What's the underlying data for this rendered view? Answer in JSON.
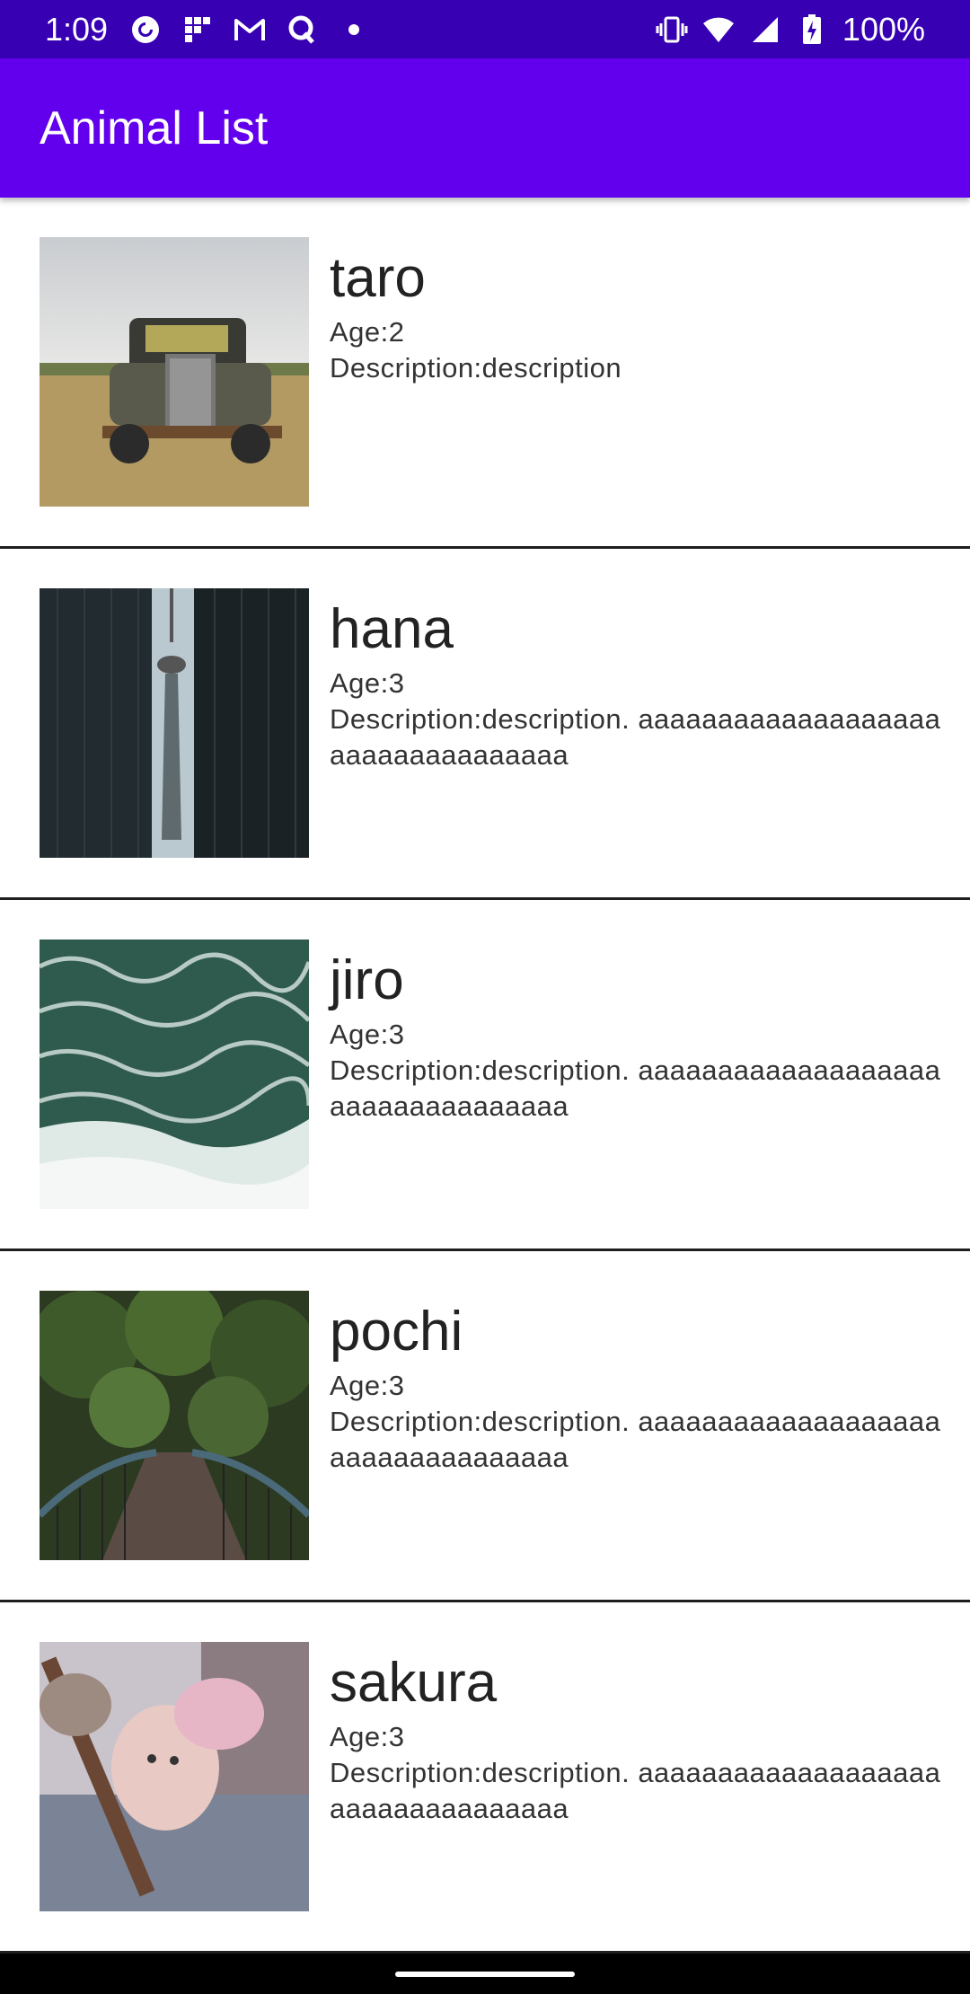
{
  "status_bar": {
    "time": "1:09",
    "battery": "100%",
    "left_icons": [
      "pocket-casts-icon",
      "grid-app-icon",
      "gmail-icon",
      "q-app-icon",
      "dot-icon"
    ],
    "right_icons": [
      "vibrate-icon",
      "wifi-icon",
      "signal-icon",
      "battery-charging-icon"
    ]
  },
  "app_bar": {
    "title": "Animal List",
    "color": "#6200ee"
  },
  "animals": [
    {
      "name": "taro",
      "age": "Age:2",
      "description": "Description:description",
      "image": "old-truck-photo"
    },
    {
      "name": "hana",
      "age": "Age:3",
      "description": "Description:description. aaaaaaaaaaaaaaaaaaaaaaaaaaaaaaaaaa",
      "image": "cn-tower-photo"
    },
    {
      "name": "jiro",
      "age": "Age:3",
      "description": "Description:description. aaaaaaaaaaaaaaaaaaaaaaaaaaaaaaaaaa",
      "image": "ocean-waves-photo"
    },
    {
      "name": "pochi",
      "age": "Age:3",
      "description": "Description:description. aaaaaaaaaaaaaaaaaaaaaaaaaaaaaaaaaa",
      "image": "forest-bridge-photo"
    },
    {
      "name": "sakura",
      "age": "Age:3",
      "description": "Description:description. aaaaaaaaaaaaaaaaaaaaaaaaaaaaaaaaaa",
      "image": "baby-photo"
    }
  ]
}
